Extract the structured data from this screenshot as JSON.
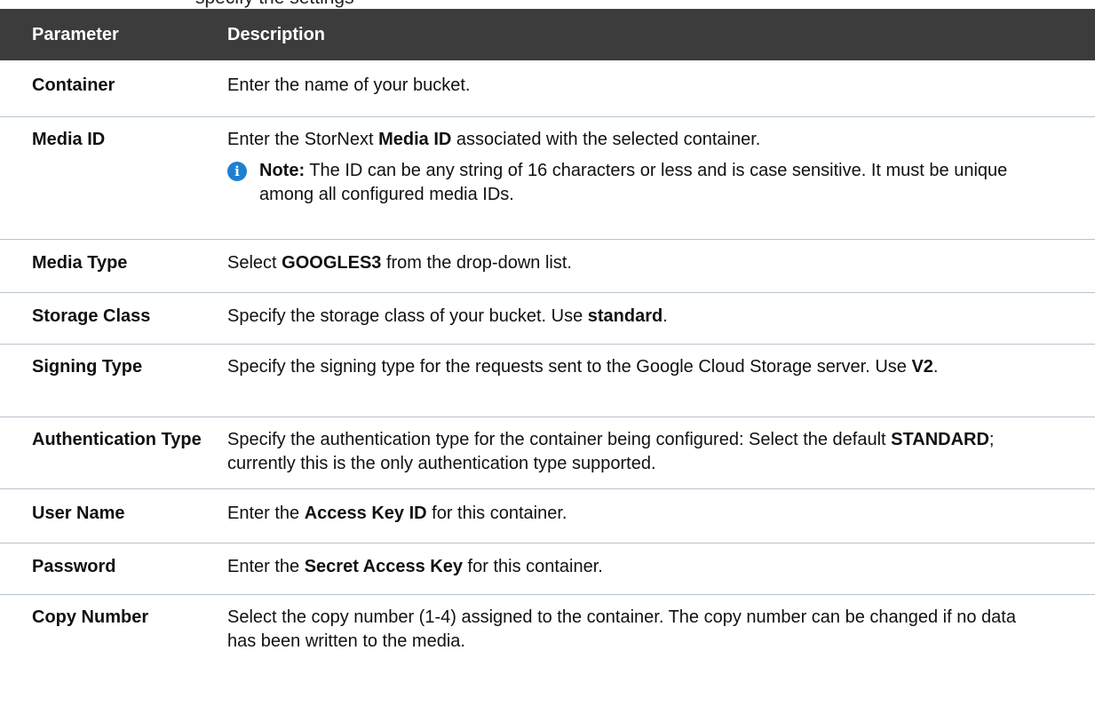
{
  "intro_clipped": "specify the settings",
  "table": {
    "header": {
      "col1": "Parameter",
      "col2": "Description"
    },
    "rows": [
      {
        "name": "Container",
        "desc_parts": [
          "Enter the name of your bucket."
        ]
      },
      {
        "name": "Media ID",
        "desc_parts": [
          "Enter the StorNext ",
          "Media ID",
          " associated with the selected container."
        ],
        "note_label": "Note:",
        "note_text": " The ID can be any string of 16 characters or less and is case sensitive. It must be unique among all configured media IDs.",
        "note_icon": "info-icon"
      },
      {
        "name": "Media Type",
        "desc_parts": [
          "Select ",
          "GOOGLES3",
          " from the drop-down list."
        ]
      },
      {
        "name": "Storage Class",
        "desc_parts": [
          "Specify the storage class of your bucket. Use ",
          "standard",
          "."
        ]
      },
      {
        "name": "Signing Type",
        "desc_parts": [
          "Specify the signing type for the requests sent to the Google Cloud Storage server. Use ",
          "V2",
          "."
        ]
      },
      {
        "name": "Authentication Type",
        "desc_parts": [
          "Specify the authentication type for the container being configured: Select the default ",
          "STANDARD",
          "; currently this is the only authentication type supported."
        ]
      },
      {
        "name": "User Name",
        "desc_parts": [
          "Enter the ",
          "Access Key ID",
          " for this container."
        ]
      },
      {
        "name": "Password",
        "desc_parts": [
          "Enter the ",
          "Secret Access Key",
          " for this container."
        ]
      },
      {
        "name": "Copy Number",
        "desc_parts": [
          "Select the copy number (1-4) assigned to the container. The copy number can be changed if no data has been written to the media."
        ]
      }
    ]
  },
  "colors": {
    "header_bg": "#3c3c3c",
    "row_divider": "#b7c4cf",
    "info_icon": "#1f7fd0"
  }
}
